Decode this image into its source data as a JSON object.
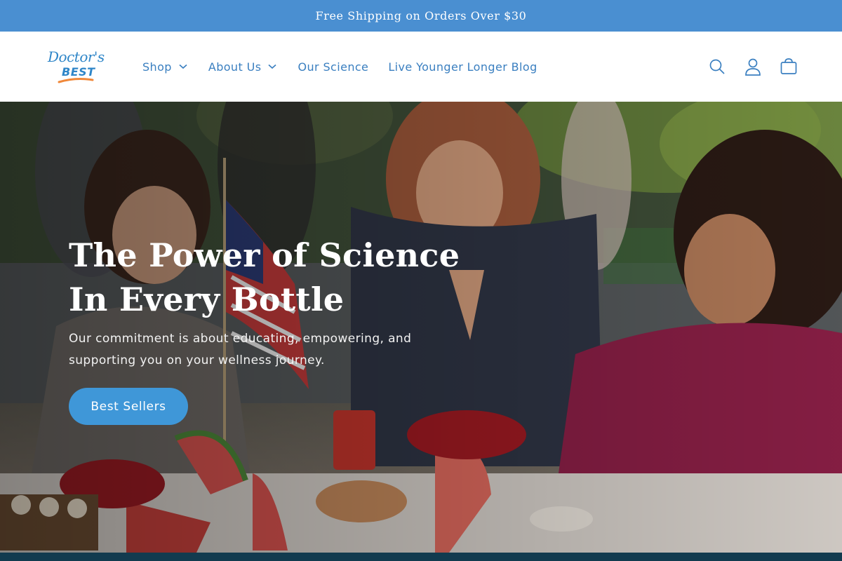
{
  "announcement": {
    "text": "Free Shipping on Orders Over $30"
  },
  "brand": {
    "logo_script": "Doctor's",
    "logo_best": "BEST",
    "color": "#2f86c8",
    "swoosh_color": "#f0883a"
  },
  "nav": {
    "items": [
      {
        "label": "Shop",
        "has_dropdown": true
      },
      {
        "label": "About Us",
        "has_dropdown": true
      },
      {
        "label": "Our Science",
        "has_dropdown": false
      },
      {
        "label": "Live Younger Longer Blog",
        "has_dropdown": false
      }
    ],
    "link_color": "#3a7fc0"
  },
  "header_icons": [
    "search-icon",
    "account-icon",
    "cart-icon"
  ],
  "hero": {
    "title": "The Power of Science In Every Bottle",
    "subtitle": "Our commitment is about educating, empowering, and supporting you on your wellness journey.",
    "button_label": "Best Sellers",
    "button_color": "#3f97d8"
  },
  "colors": {
    "announcement_bg": "#4a8fd1",
    "footer_strip": "#123b4f"
  }
}
